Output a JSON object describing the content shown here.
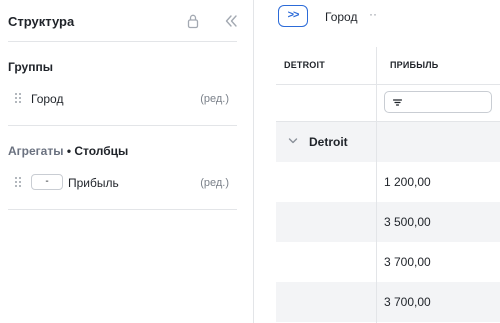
{
  "panel": {
    "title": "Структура",
    "groups_title": "Группы",
    "groups": [
      {
        "label": "Город",
        "edit": "(ред.)"
      }
    ],
    "aggregates_title": "Агрегаты",
    "columns_title": "• Столбцы",
    "aggregates": [
      {
        "agg": "-",
        "label": "Прибыль",
        "edit": "(ред.)"
      }
    ]
  },
  "topbar": {
    "toggle_label": ">>",
    "group_chip": "Город",
    "more": "··"
  },
  "grid": {
    "columns": [
      "DETROIT",
      "ПРИБЫЛЬ"
    ],
    "group_row_label": "Detroit",
    "rows": [
      "1 200,00",
      "3 500,00",
      "3 700,00",
      "3 700,00"
    ]
  },
  "colors": {
    "accent": "#2c6bd8",
    "row_alt": "#f3f4f6",
    "border": "#e3e5e8"
  }
}
